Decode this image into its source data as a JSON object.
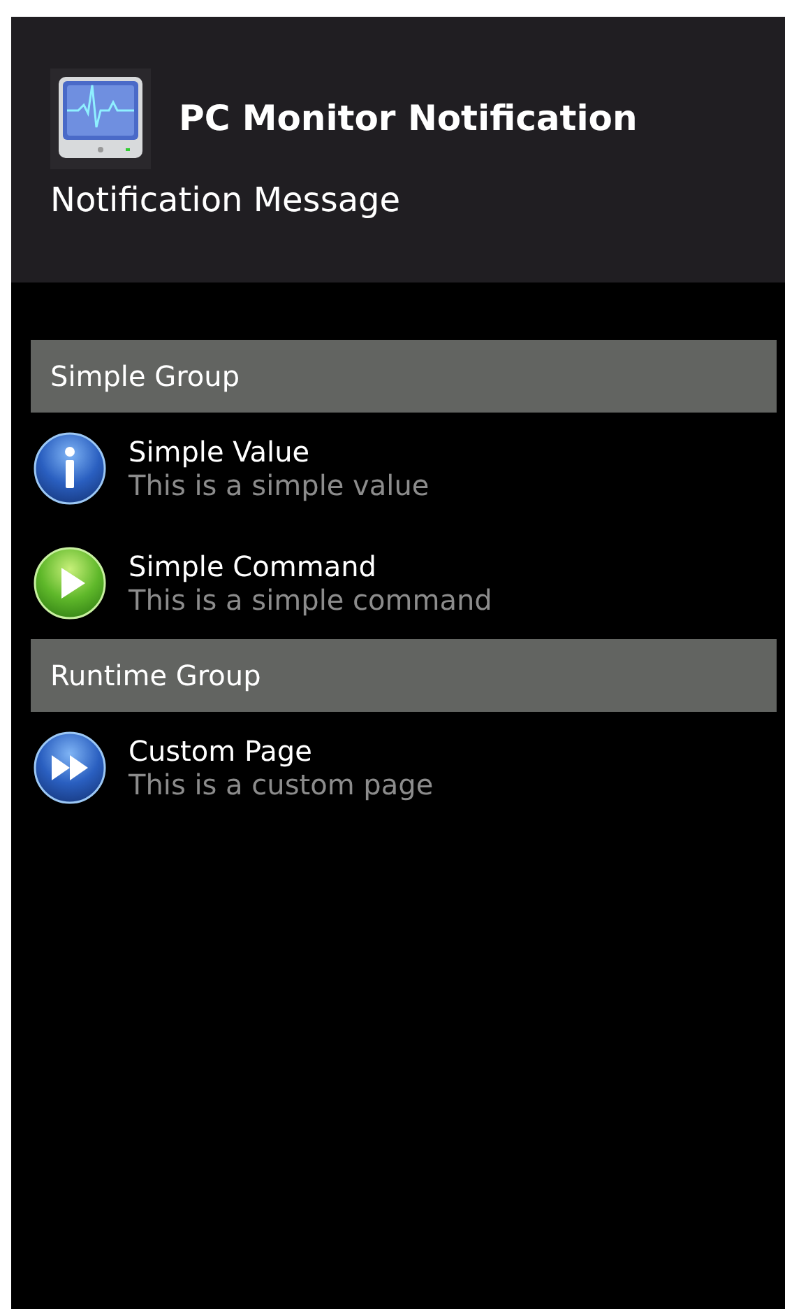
{
  "notification": {
    "title": "PC Monitor Notification",
    "message": "Notification Message"
  },
  "groups": [
    {
      "title": "Simple Group",
      "items": [
        {
          "kind": "info",
          "title": "Simple Value",
          "subtitle": "This is a simple value"
        },
        {
          "kind": "command",
          "title": "Simple Command",
          "subtitle": "This is a simple command"
        }
      ]
    },
    {
      "title": "Runtime Group",
      "items": [
        {
          "kind": "page",
          "title": "Custom Page",
          "subtitle": "This is a custom page"
        }
      ]
    }
  ]
}
